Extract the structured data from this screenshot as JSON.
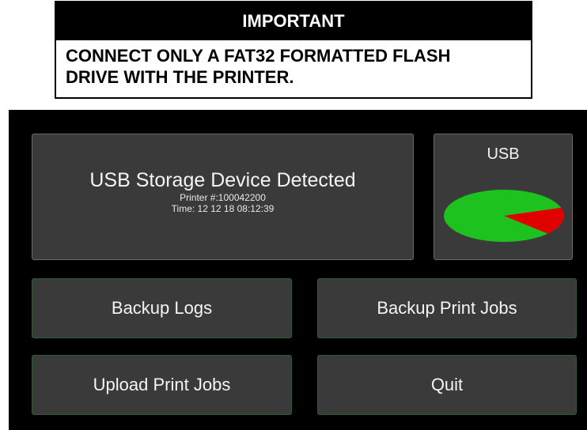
{
  "notice": {
    "header": "IMPORTANT",
    "body_line1": "CONNECT ONLY A FAT32 FORMATTED FLASH",
    "body_line2": "DRIVE WITH THE PRINTER."
  },
  "status": {
    "title": "USB Storage Device Detected",
    "printer_line": "Printer #:100042200",
    "time_line": "Time: 12 12 18 08:12:39"
  },
  "usb": {
    "label": "USB",
    "used_fraction": 0.17,
    "free_color": "#1ec21e",
    "used_color": "#e00000"
  },
  "buttons": {
    "backup_logs": "Backup Logs",
    "backup_print_jobs": "Backup Print Jobs",
    "upload_print_jobs": "Upload Print Jobs",
    "quit": "Quit"
  },
  "colors": {
    "screen_bg": "#000000",
    "panel_bg": "#3a3a3a",
    "button_border": "#2f5a33"
  }
}
